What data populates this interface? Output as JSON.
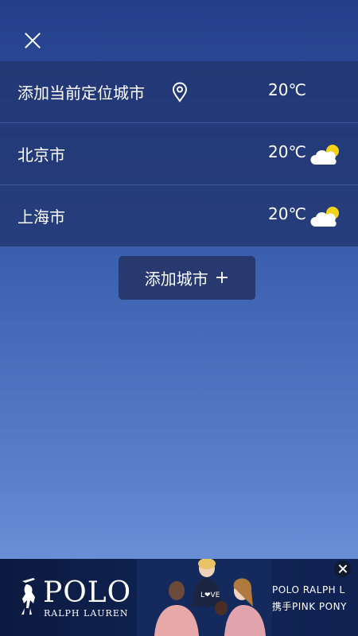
{
  "header": {
    "close_icon": "close-icon"
  },
  "cities": [
    {
      "name": "添加当前定位城市",
      "icon": "location-pin-icon",
      "temp": "20℃"
    },
    {
      "name": "北京市",
      "weather_icon": "partly-cloudy-icon",
      "temp": "20℃"
    },
    {
      "name": "上海市",
      "weather_icon": "partly-cloudy-icon",
      "temp": "20℃"
    }
  ],
  "add_city": {
    "label": "添加城市",
    "icon": "+"
  },
  "ad": {
    "brand": "POLO",
    "brand_sub": "RALPH LAUREN",
    "line1": "POLO RALPH L",
    "line2": "携手PINK PONY"
  },
  "colors": {
    "row_bg": "#21346e",
    "button_bg": "#27396f",
    "sun": "#f5d21a",
    "cloud": "#ffffff"
  }
}
